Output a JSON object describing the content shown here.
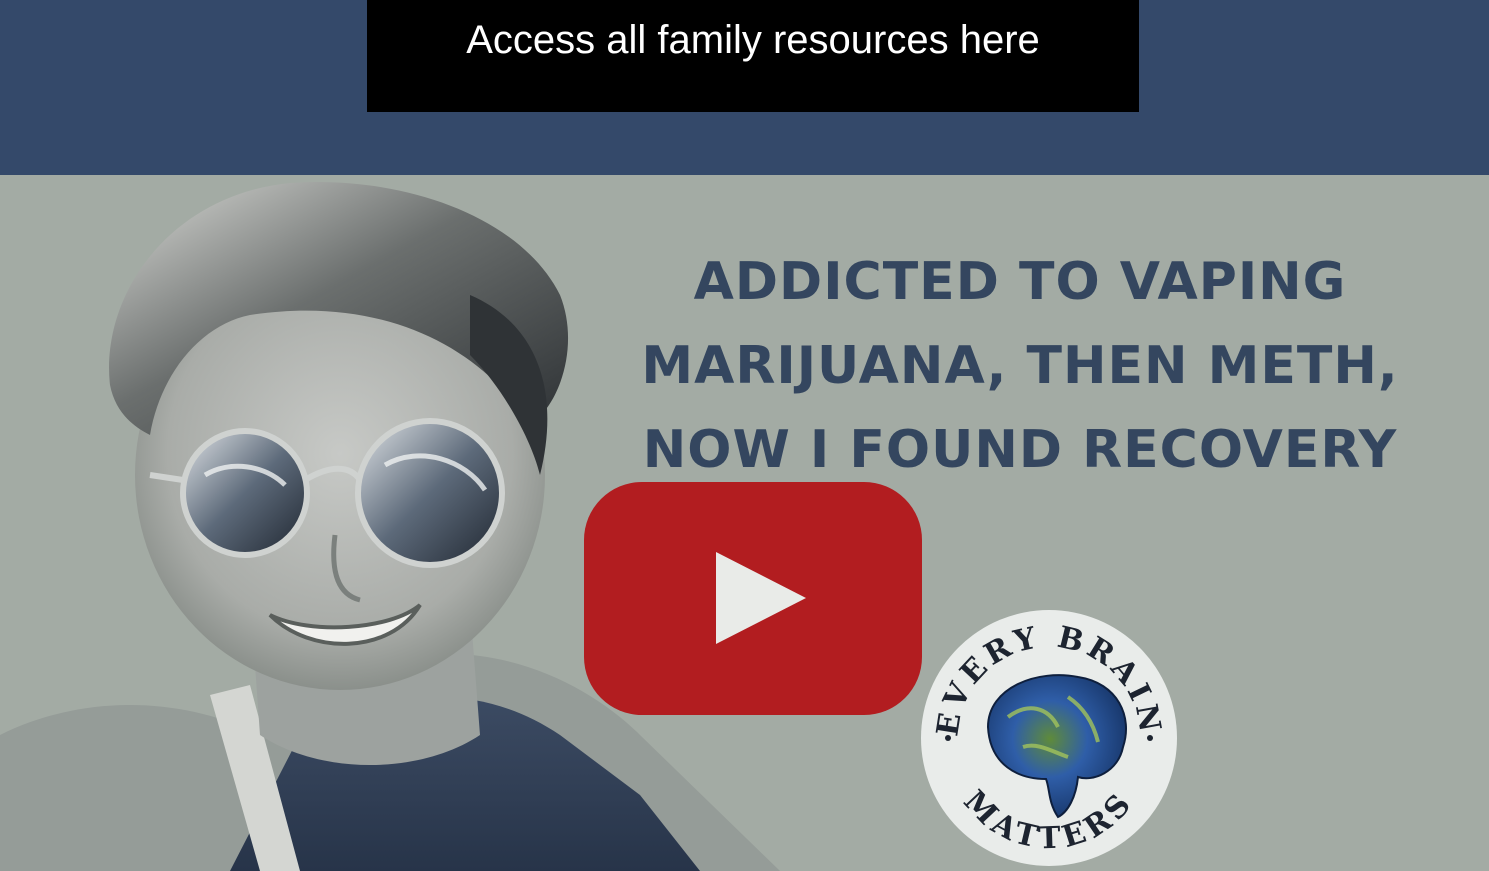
{
  "header": {
    "resources_button_label": "Access all family resources here"
  },
  "video": {
    "headline_lines": [
      "ADDICTED TO VAPING",
      "MARIJUANA, THEN METH,",
      "NOW I FOUND RECOVERY"
    ],
    "play_icon": "youtube-play-icon",
    "logo": {
      "top_text": "EVERY BRAIN",
      "bottom_text": "MATTERS"
    }
  },
  "colors": {
    "header_background": "#34496a",
    "button_background": "#000000",
    "button_text": "#ffffff",
    "thumbnail_background": "#a3aba4",
    "headline_text": "#34465f",
    "play_button_red": "#b21d20"
  }
}
